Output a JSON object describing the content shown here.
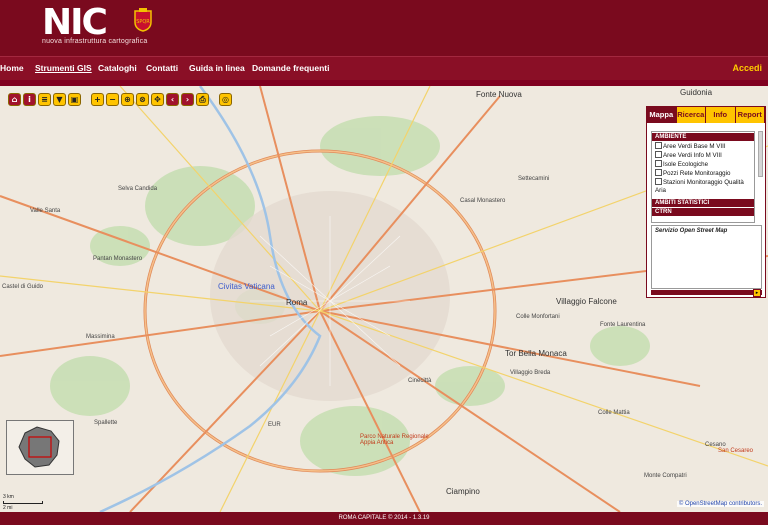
{
  "header": {
    "logo_text": "NIC",
    "subtitle": "nuova infrastruttura cartografica"
  },
  "nav": {
    "items": [
      "Home",
      "Strumenti GIS",
      "Cataloghi",
      "Contatti",
      "Guida in linea",
      "Domande frequenti"
    ],
    "active": "Strumenti GIS",
    "login": "Accedi"
  },
  "toolbar": {
    "buttons": [
      "home-icon",
      "info-icon",
      "measure-icon",
      "select-icon",
      "print-icon",
      "zoom-in-icon",
      "zoom-out-icon",
      "zoom-box-icon",
      "zoom-extent-icon",
      "pan-icon",
      "back-icon",
      "forward-icon",
      "print-icon",
      "layers-icon"
    ]
  },
  "panel": {
    "tabs": [
      "Mappa",
      "Ricerca",
      "Info",
      "Report"
    ],
    "active_tab": "Mappa",
    "groups": [
      {
        "title": "AMBIENTE",
        "items": [
          "Aree Verdi Base M VIII",
          "Aree Verdi Info M VIII",
          "Isole Ecologiche",
          "Pozzi Rete Monitoraggio",
          "Stazioni Monitoraggio Qualità Aria"
        ]
      },
      {
        "title": "AMBITI STATISTICI",
        "items": []
      },
      {
        "title": "CTRN",
        "items": []
      }
    ],
    "service_text": "Servizio Open Street Map"
  },
  "map": {
    "places": [
      {
        "name": "Fonte Nuova",
        "kind": "big"
      },
      {
        "name": "Guidonia",
        "kind": "big"
      },
      {
        "name": "Civitas Vaticana",
        "kind": "big"
      },
      {
        "name": "Roma",
        "kind": "big"
      },
      {
        "name": "Villaggio Falcone",
        "kind": "big"
      },
      {
        "name": "Tor Bella Monaca",
        "kind": "big"
      },
      {
        "name": "Ciampino",
        "kind": "big"
      },
      {
        "name": "Castel di Guido",
        "kind": "normal"
      },
      {
        "name": "Massimina",
        "kind": "normal"
      },
      {
        "name": "Spallette",
        "kind": "normal"
      },
      {
        "name": "EUR",
        "kind": "normal"
      },
      {
        "name": "Cinecittà",
        "kind": "normal"
      },
      {
        "name": "Parco Naturale Regionale Appia Antica",
        "kind": "normal"
      },
      {
        "name": "Selva Candida",
        "kind": "normal"
      },
      {
        "name": "Valle Santa",
        "kind": "normal"
      },
      {
        "name": "Pantan Monastero",
        "kind": "normal"
      },
      {
        "name": "Monte Compatri",
        "kind": "normal"
      },
      {
        "name": "Colle Monfortani",
        "kind": "normal"
      },
      {
        "name": "Fonte Laurentina",
        "kind": "normal"
      },
      {
        "name": "Cesano",
        "kind": "normal"
      },
      {
        "name": "Villaggio Breda",
        "kind": "normal"
      },
      {
        "name": "San Cesareo",
        "kind": "normal"
      },
      {
        "name": "Casal Monastero",
        "kind": "normal"
      },
      {
        "name": "Settecamini",
        "kind": "normal"
      },
      {
        "name": "Colle Mattia",
        "kind": "normal"
      }
    ],
    "scale": [
      "3 km",
      "2 mi"
    ],
    "attribution": "© OpenStreetMap contributors."
  },
  "footer": {
    "text": "ROMA CAPITALE © 2014 - 1.3.19"
  }
}
